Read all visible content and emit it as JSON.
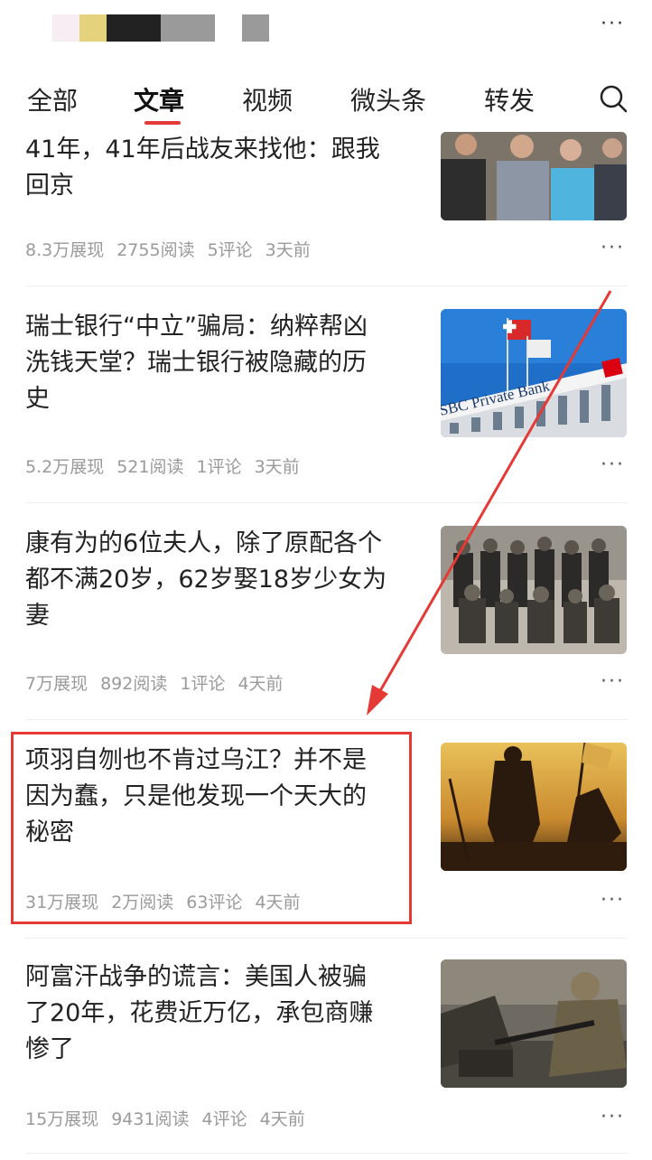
{
  "header": {
    "more_label": "···"
  },
  "tabs": [
    {
      "label": "全部"
    },
    {
      "label": "文章",
      "active": true
    },
    {
      "label": "视频"
    },
    {
      "label": "微头条"
    },
    {
      "label": "转发"
    }
  ],
  "articles": [
    {
      "title": "41年，41年后战友来找他：跟我回京",
      "title_line1": "41年，41年后战友来找他：跟我",
      "title_line2": "回京",
      "views": "8.3万展现",
      "reads": "2755阅读",
      "comments": "5评论",
      "time": "3天前"
    },
    {
      "title_line1": "瑞士银行“中立”骗局：纳粹帮凶",
      "title_line2": "洗钱天堂？瑞士银行被隐藏的历",
      "title_line3": "史",
      "thumb_text": "SBC Private Bank",
      "views": "5.2万展现",
      "reads": "521阅读",
      "comments": "1评论",
      "time": "3天前"
    },
    {
      "title_line1": "康有为的6位夫人，除了原配各个",
      "title_line2": "都不满20岁，62岁娶18岁少女为",
      "title_line3": "妻",
      "views": "7万展现",
      "reads": "892阅读",
      "comments": "1评论",
      "time": "4天前"
    },
    {
      "title_line1": "项羽自刎也不肯过乌江？并不是",
      "title_line2": "因为蠢，只是他发现一个天大的",
      "title_line3": "秘密",
      "views": "31万展现",
      "reads": "2万阅读",
      "comments": "63评论",
      "time": "4天前"
    },
    {
      "title_line1": "阿富汗战争的谎言：美国人被骗",
      "title_line2": "了20年，花费近万亿，承包商赚",
      "title_line3": "惨了",
      "views": "15万展现",
      "reads": "9431阅读",
      "comments": "4评论",
      "time": "4天前"
    }
  ],
  "more_label": "···",
  "colors": {
    "accent": "#e53935",
    "meta": "#9a9a9a"
  }
}
